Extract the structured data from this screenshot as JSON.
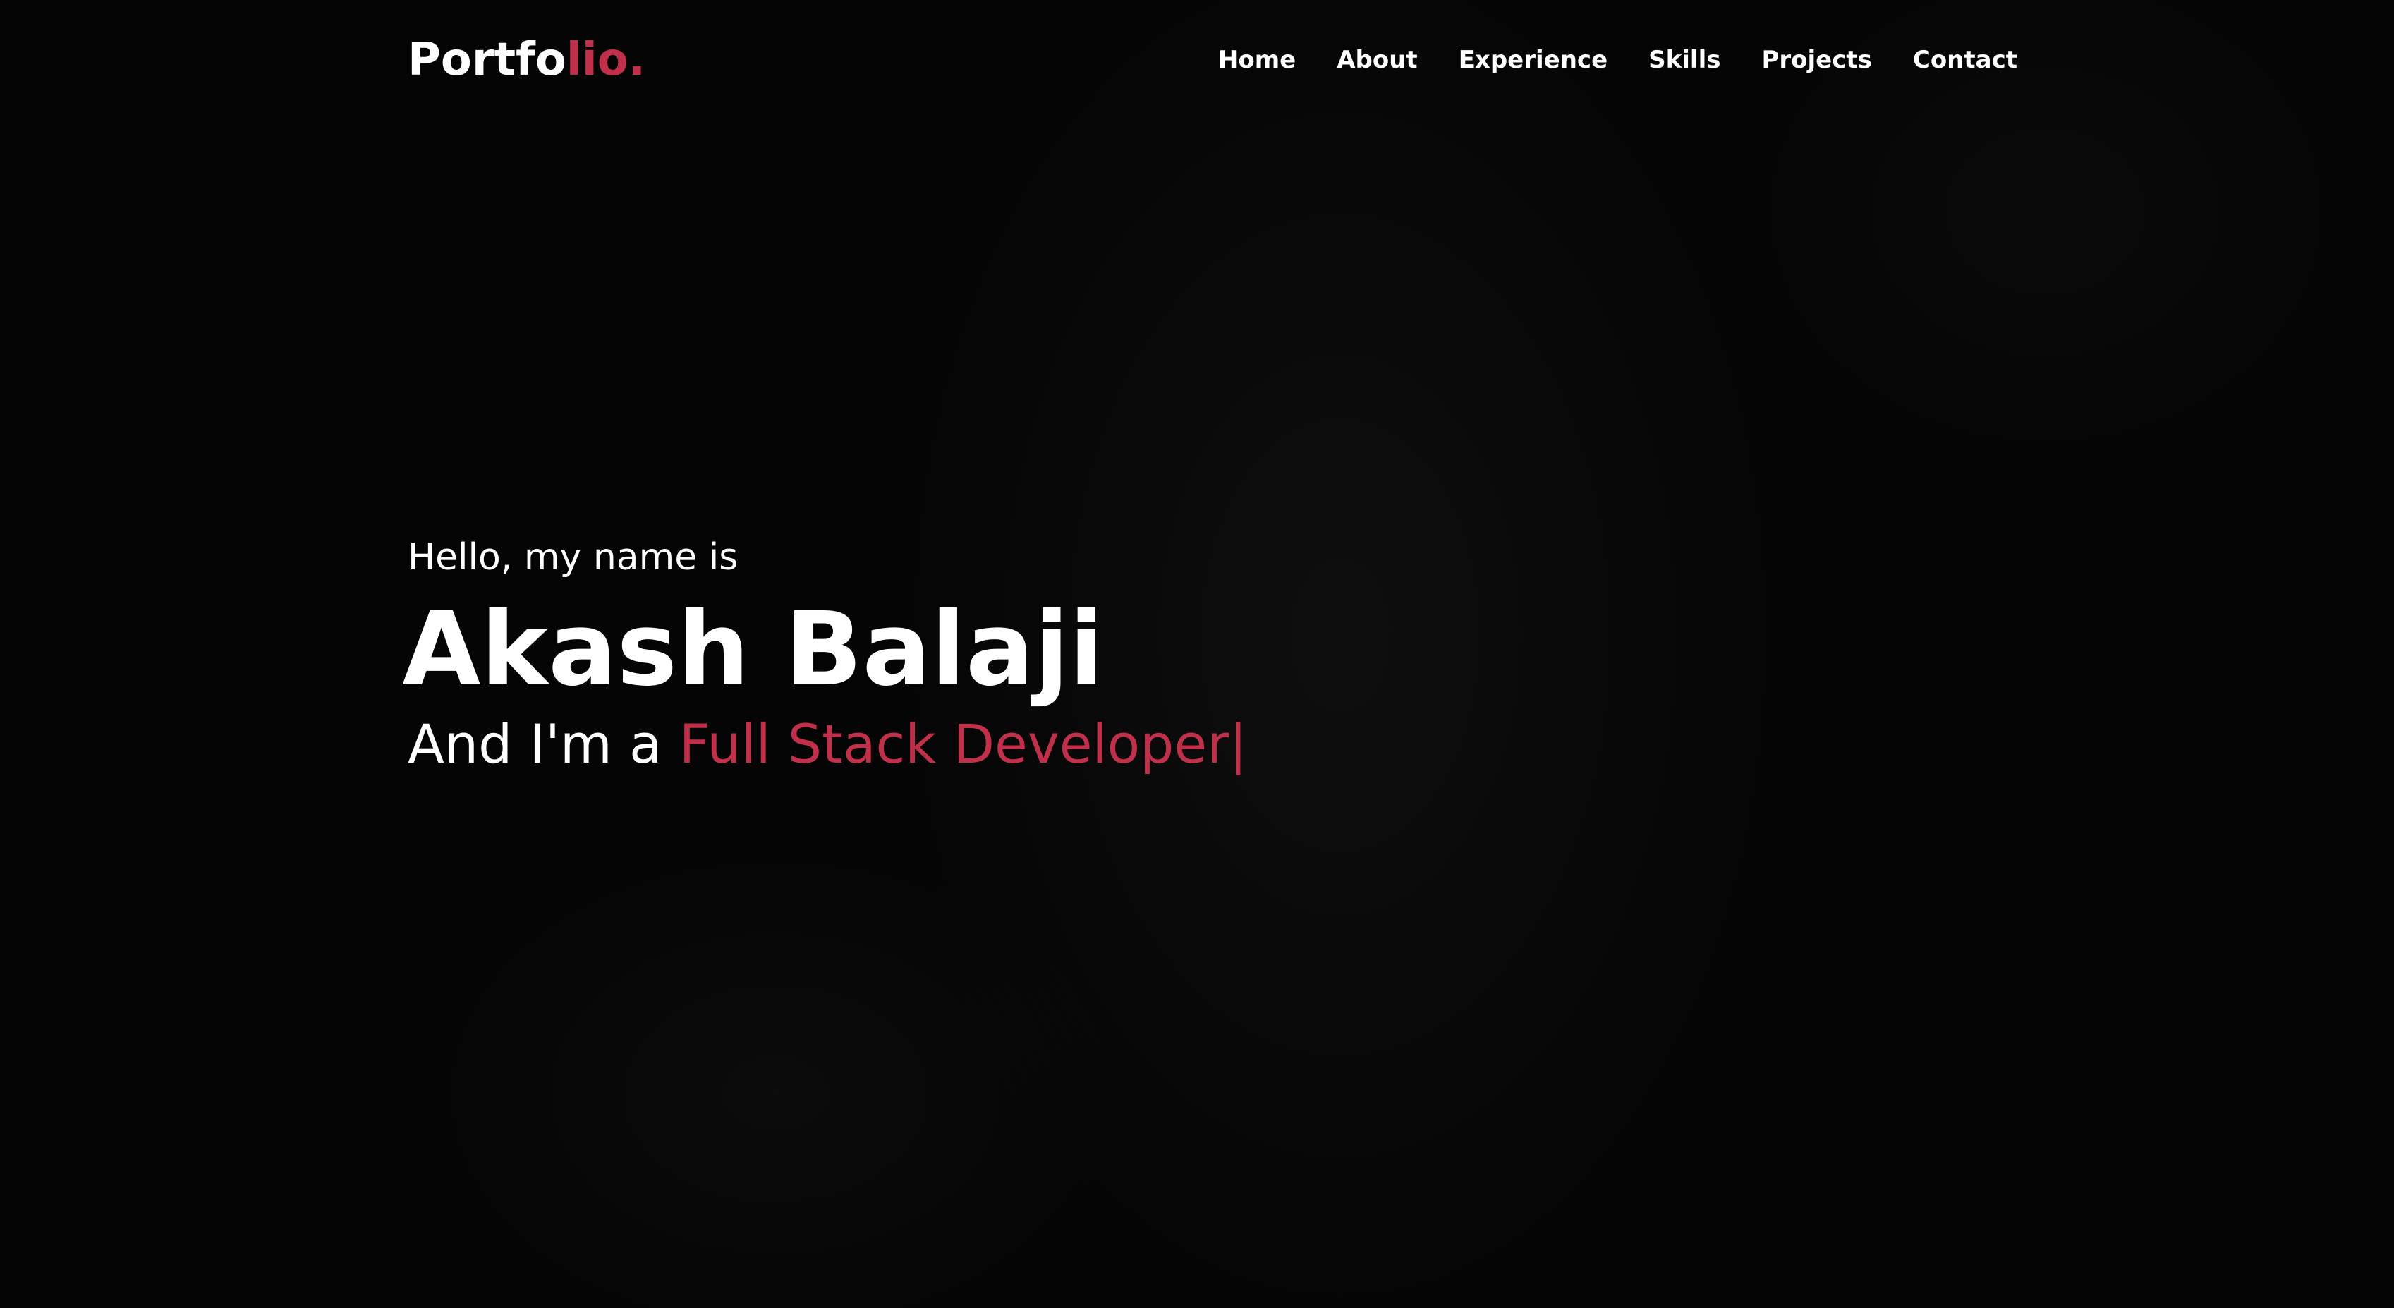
{
  "logo": {
    "main": "Portfo",
    "accent": "lio."
  },
  "nav": {
    "items": [
      {
        "label": "Home"
      },
      {
        "label": "About"
      },
      {
        "label": "Experience"
      },
      {
        "label": "Skills"
      },
      {
        "label": "Projects"
      },
      {
        "label": "Contact"
      }
    ]
  },
  "hero": {
    "greeting": "Hello, my name is",
    "name": "Akash Balaji",
    "role_prefix": "And I'm a ",
    "role": "Full Stack Developer",
    "cursor": "|"
  },
  "colors": {
    "accent": "#c0304a",
    "background": "#050505",
    "text": "#ffffff"
  }
}
